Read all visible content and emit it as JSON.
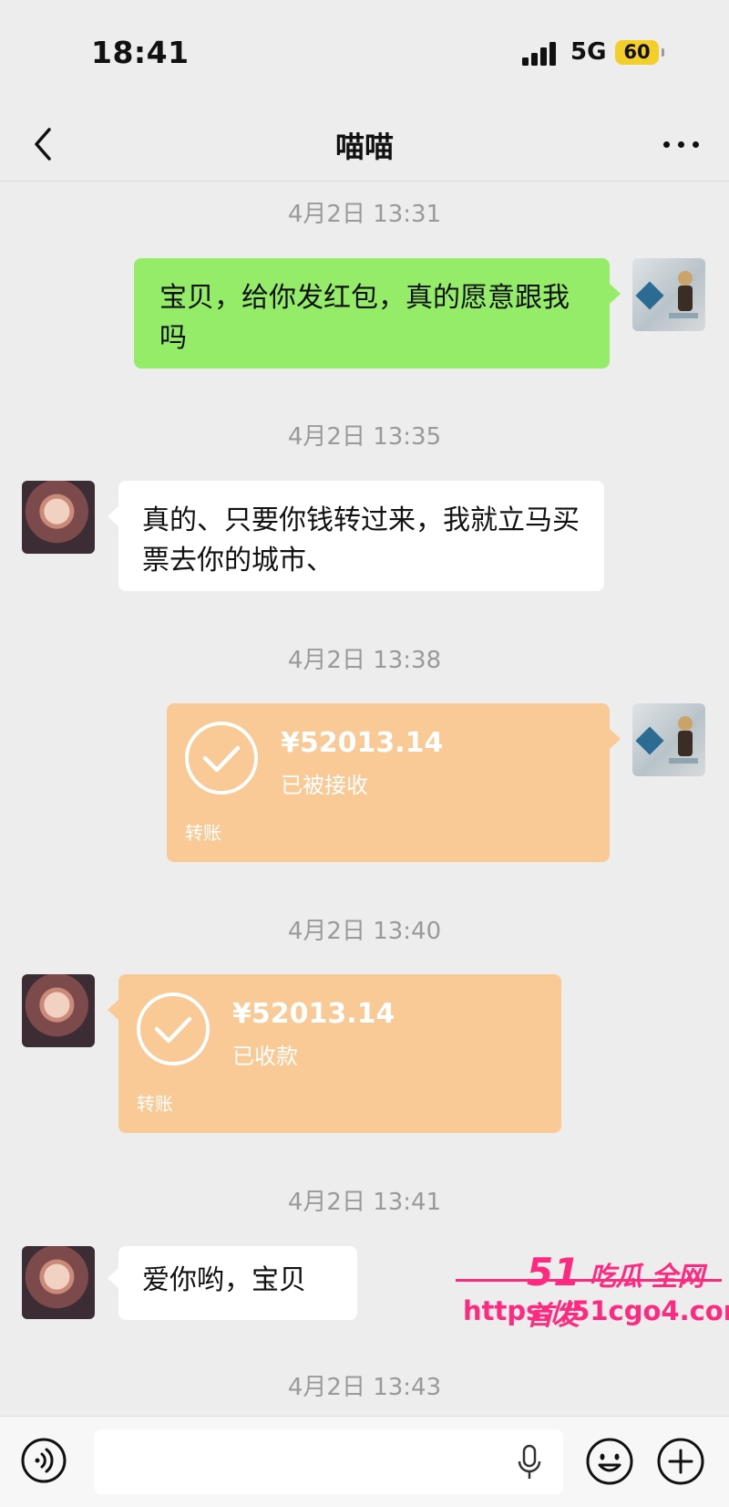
{
  "status_bar": {
    "time": "18:41",
    "network": "5G",
    "battery": "60"
  },
  "header": {
    "title": "喵喵"
  },
  "messages": {
    "ts1": "4月2日 13:31",
    "msg1": "宝贝，给你发红包，真的愿意跟我吗",
    "ts2": "4月2日 13:35",
    "msg2": "真的、只要你钱转过来，我就立马买票去你的城市、",
    "ts3": "4月2日 13:38",
    "transfer1": {
      "amount": "¥52013.14",
      "status": "已被接收",
      "type": "转账"
    },
    "ts4": "4月2日 13:40",
    "transfer2": {
      "amount": "¥52013.14",
      "status": "已收款",
      "type": "转账"
    },
    "ts5": "4月2日 13:41",
    "msg3": "爱你哟，宝贝",
    "ts6": "4月2日 13:43"
  },
  "watermark": {
    "brand_num": "51",
    "brand_text": "吃瓜 全网首发",
    "url": "https://51cgo4.com"
  },
  "colors": {
    "green_bubble": "#95ec69",
    "transfer": "#f9c996",
    "background": "#ededed",
    "watermark": "#ff2a7f"
  },
  "icons": [
    "back-arrow-icon",
    "more-dots-icon",
    "voice-icon",
    "microphone-icon",
    "emoji-icon",
    "plus-icon",
    "check-circle-icon"
  ]
}
